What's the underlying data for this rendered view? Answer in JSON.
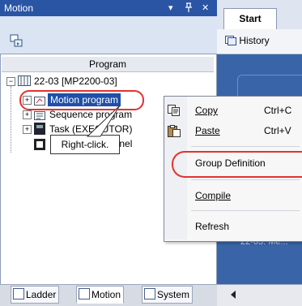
{
  "panel": {
    "title": "Motion",
    "pin_glyph": "▾",
    "float_glyph": "ᵖ",
    "close_glyph": "✕",
    "toolbar_icon": "project-tree-icon"
  },
  "tree": {
    "header": "Program",
    "root": {
      "label": "22-03 [MP2200-03]",
      "expander": "−"
    },
    "items": [
      {
        "label": "Motion program",
        "expander": "+",
        "icon": "motion-program-icon"
      },
      {
        "label": "Sequence program",
        "expander": "+",
        "icon": "sequence-program-icon"
      },
      {
        "label": "Task (EXECUTOR)",
        "expander": "+",
        "icon": "task-icon"
      },
      {
        "label": "I Panel",
        "expander": "",
        "icon": "panel-icon"
      }
    ]
  },
  "callout": {
    "text": "Right-click."
  },
  "bottom_tabs": [
    {
      "label": "Ladder",
      "icon": "ladder-icon"
    },
    {
      "label": "Motion",
      "icon": "motion-icon"
    },
    {
      "label": "System",
      "icon": "system-icon"
    }
  ],
  "right": {
    "tab": "Start",
    "history": "History",
    "blurred_text": "22-03. Me..."
  },
  "context_menu": {
    "items": [
      {
        "label": "Copy",
        "accel": "C",
        "shortcut": "Ctrl+C",
        "icon": "copy-icon"
      },
      {
        "label": "Paste",
        "accel": "P",
        "shortcut": "Ctrl+V",
        "icon": "paste-icon"
      },
      {
        "label": "Group Definition",
        "accel": "G",
        "shortcut": ""
      },
      {
        "label": "Compile",
        "accel": "C",
        "shortcut": ""
      },
      {
        "label": "Refresh",
        "accel": "f",
        "shortcut": ""
      }
    ]
  },
  "colors": {
    "title_bar": "#2a55a5",
    "annotation_red": "#e23330",
    "start_page": "#3a64a8"
  }
}
